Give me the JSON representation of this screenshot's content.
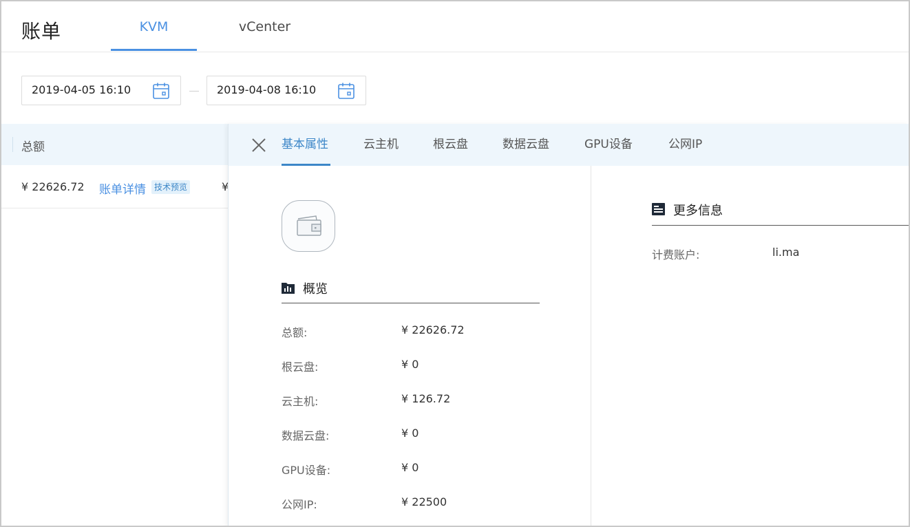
{
  "header": {
    "title": "账单",
    "tabs": [
      {
        "label": "KVM",
        "active": true
      },
      {
        "label": "vCenter",
        "active": false
      }
    ]
  },
  "date_range": {
    "start": "2019-04-05 16:10",
    "end": "2019-04-08 16:10"
  },
  "bill_list": {
    "column_header": "总额",
    "rows": [
      {
        "amount": "¥ 22626.72",
        "link": "账单详情",
        "badge": "技术预览",
        "truncated": "¥"
      }
    ]
  },
  "detail": {
    "tabs": [
      "基本属性",
      "云主机",
      "根云盘",
      "数据云盘",
      "GPU设备",
      "公网IP"
    ],
    "active_tab": "基本属性",
    "overview": {
      "title": "概览",
      "items": [
        {
          "label": "总额:",
          "value": "¥ 22626.72"
        },
        {
          "label": "根云盘:",
          "value": "¥ 0"
        },
        {
          "label": "云主机:",
          "value": "¥ 126.72"
        },
        {
          "label": "数据云盘:",
          "value": "¥ 0"
        },
        {
          "label": "GPU设备:",
          "value": "¥ 0"
        },
        {
          "label": "公网IP:",
          "value": "¥ 22500"
        }
      ]
    },
    "more_info": {
      "title": "更多信息",
      "items": [
        {
          "label": "计费账户:",
          "value": "li.ma"
        }
      ]
    }
  },
  "icons": {
    "calendar": "calendar-icon",
    "close": "close-icon",
    "wallet": "wallet-icon",
    "overview": "folder-chart-icon",
    "more_info": "info-card-icon"
  },
  "colors": {
    "accent": "#4a90e2",
    "tab_bar_bg": "#eef6fc",
    "badge_bg": "#e3f1fb"
  }
}
